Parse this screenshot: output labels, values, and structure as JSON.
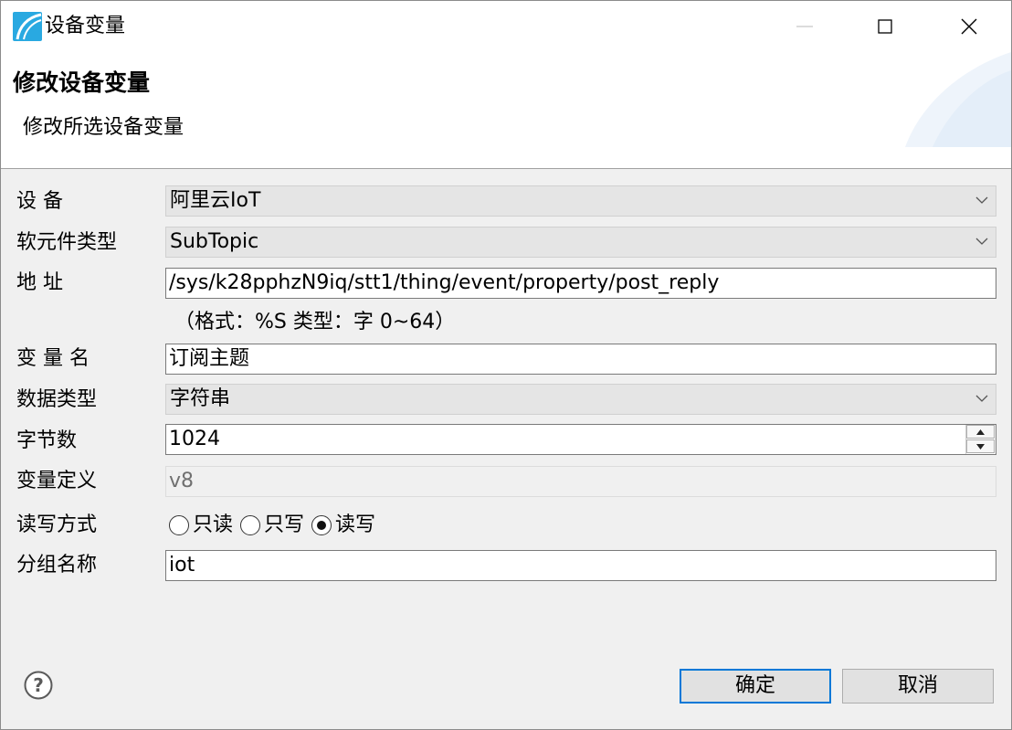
{
  "window": {
    "title": "设备变量"
  },
  "header": {
    "title": "修改设备变量",
    "description": "修改所选设备变量"
  },
  "form": {
    "device": {
      "label": "设 备",
      "value": "阿里云IoT"
    },
    "element_type": {
      "label": "软元件类型",
      "value": "SubTopic"
    },
    "address": {
      "label": "地 址",
      "value": "/sys/k28pphzN9iq/stt1/thing/event/property/post_reply",
      "hint": "（格式：%S 类型：字 0~64）"
    },
    "var_name": {
      "label": "变 量 名",
      "value": "订阅主题"
    },
    "data_type": {
      "label": "数据类型",
      "value": "字符串"
    },
    "byte_count": {
      "label": "字节数",
      "value": "1024"
    },
    "var_def": {
      "label": "变量定义",
      "value": "v8"
    },
    "rw_mode": {
      "label": "读写方式",
      "options": [
        {
          "label": "只读",
          "checked": false
        },
        {
          "label": "只写",
          "checked": false
        },
        {
          "label": "读写",
          "checked": true
        }
      ]
    },
    "group_name": {
      "label": "分组名称",
      "value": "iot"
    }
  },
  "buttons": {
    "ok": "确定",
    "cancel": "取消"
  },
  "icons": {
    "app": "app-logo-icon",
    "minimize": "minimize-icon",
    "maximize": "maximize-icon",
    "close": "close-icon",
    "dropdown": "chevron-down-icon",
    "help": "help-icon"
  },
  "colors": {
    "accent": "#0078d7",
    "app_icon": "#29a9e1"
  }
}
